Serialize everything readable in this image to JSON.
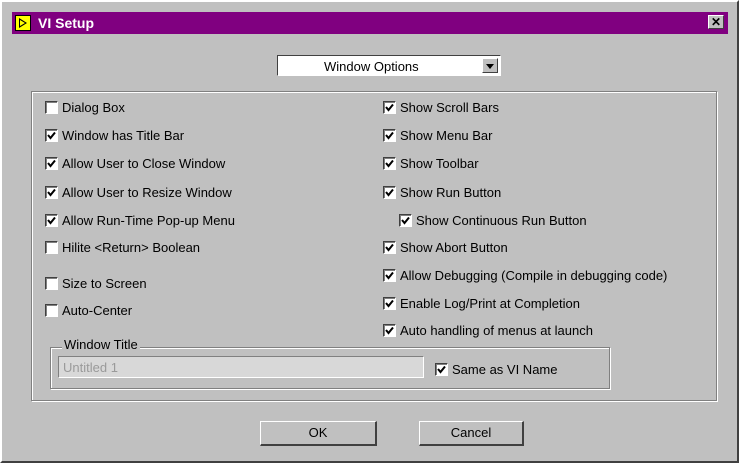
{
  "window": {
    "title": "VI Setup",
    "close_label": "✕"
  },
  "category_select": {
    "value": "Window Options"
  },
  "options_left": [
    {
      "label": "Dialog Box",
      "checked": false
    },
    {
      "label": "Window has Title Bar",
      "checked": true
    },
    {
      "label": "Allow User to Close Window",
      "checked": true
    },
    {
      "label": "Allow User to Resize Window",
      "checked": true
    },
    {
      "label": "Allow Run-Time Pop-up Menu",
      "checked": true
    },
    {
      "label": "Hilite <Return> Boolean",
      "checked": false
    },
    {
      "label": "Size to Screen",
      "checked": false
    },
    {
      "label": "Auto-Center",
      "checked": false
    }
  ],
  "options_right": [
    {
      "label": "Show Scroll Bars",
      "checked": true
    },
    {
      "label": "Show Menu Bar",
      "checked": true
    },
    {
      "label": "Show Toolbar",
      "checked": true
    },
    {
      "label": "Show Run Button",
      "checked": true
    },
    {
      "label": "Show Continuous Run Button",
      "checked": true
    },
    {
      "label": "Show Abort Button",
      "checked": true
    },
    {
      "label": "Allow Debugging (Compile in debugging code)",
      "checked": true
    },
    {
      "label": "Enable Log/Print at Completion",
      "checked": true
    },
    {
      "label": "Auto handling of menus at launch",
      "checked": true
    }
  ],
  "window_title": {
    "legend": "Window Title",
    "value": "Untitled 1",
    "same_as_vi_label": "Same as VI Name",
    "same_as_vi_checked": true
  },
  "buttons": {
    "ok": "OK",
    "cancel": "Cancel"
  }
}
